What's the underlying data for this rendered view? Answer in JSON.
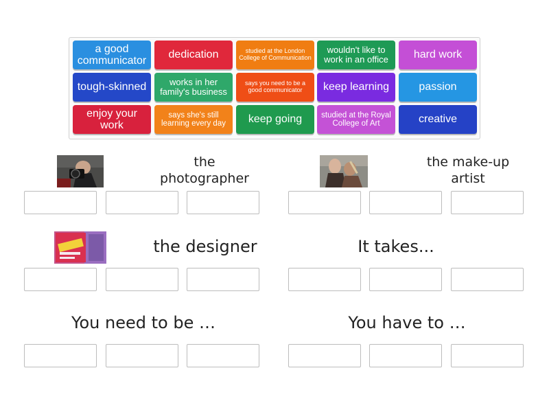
{
  "tiles": [
    {
      "text": "a good communicator",
      "color": "#2a8fe0"
    },
    {
      "text": "dedication",
      "color": "#e0283b"
    },
    {
      "text": "studied at the London College of Communication",
      "color": "#f07d12"
    },
    {
      "text": "wouldn't like to work in an office",
      "color": "#1e9a55"
    },
    {
      "text": "hard work",
      "color": "#c44fd6"
    },
    {
      "text": "tough-skinned",
      "color": "#2448c8"
    },
    {
      "text": "works in her family's business",
      "color": "#2fa86a"
    },
    {
      "text": "says you need to be a good communicator",
      "color": "#ef4e16"
    },
    {
      "text": "keep learning",
      "color": "#7a2be0"
    },
    {
      "text": "passion",
      "color": "#2596e3"
    },
    {
      "text": "enjoy your work",
      "color": "#d8213d"
    },
    {
      "text": "says she's still learning every day",
      "color": "#f2821a"
    },
    {
      "text": "keep going",
      "color": "#1f9a4e"
    },
    {
      "text": "studied at the Royal College of Art",
      "color": "#c452d6"
    },
    {
      "text": "creative",
      "color": "#2542c6"
    }
  ],
  "groups": [
    {
      "heading": "the photographer",
      "image": "photographer-photo"
    },
    {
      "heading": "the make-up artist",
      "image": "make-up-artist-photo"
    },
    {
      "heading": "the designer",
      "image": "designer-book-cover"
    },
    {
      "heading": "It takes..."
    },
    {
      "heading": "You need to be …"
    },
    {
      "heading": "You have to …"
    }
  ]
}
